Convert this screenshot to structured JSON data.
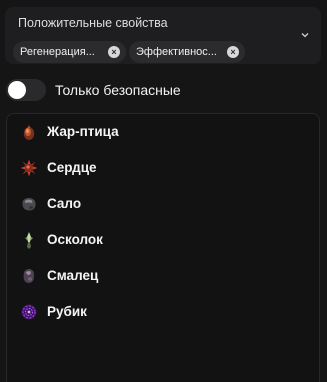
{
  "filter": {
    "label": "Положительные свойства",
    "chips": [
      "Регенерация...",
      "Эффективнос..."
    ],
    "chip_close_glyph": "×",
    "dropdown_icon": "chevron-down-icon"
  },
  "toggle": {
    "label": "Только безопасные",
    "on": false
  },
  "items": [
    {
      "label": "Жар-птица",
      "icon": "firebird-artifact-icon",
      "color": "#c0462f"
    },
    {
      "label": "Сердце",
      "icon": "heart-artifact-icon",
      "color": "#b23a2a"
    },
    {
      "label": "Сало",
      "icon": "lard-artifact-icon",
      "color": "#5b5d63"
    },
    {
      "label": "Осколок",
      "icon": "shard-artifact-icon",
      "color": "#8fae6b"
    },
    {
      "label": "Смалец",
      "icon": "fat-artifact-icon",
      "color": "#6e5c73"
    },
    {
      "label": "Рубик",
      "icon": "rubik-artifact-icon",
      "color": "#8a2fc7"
    }
  ]
}
